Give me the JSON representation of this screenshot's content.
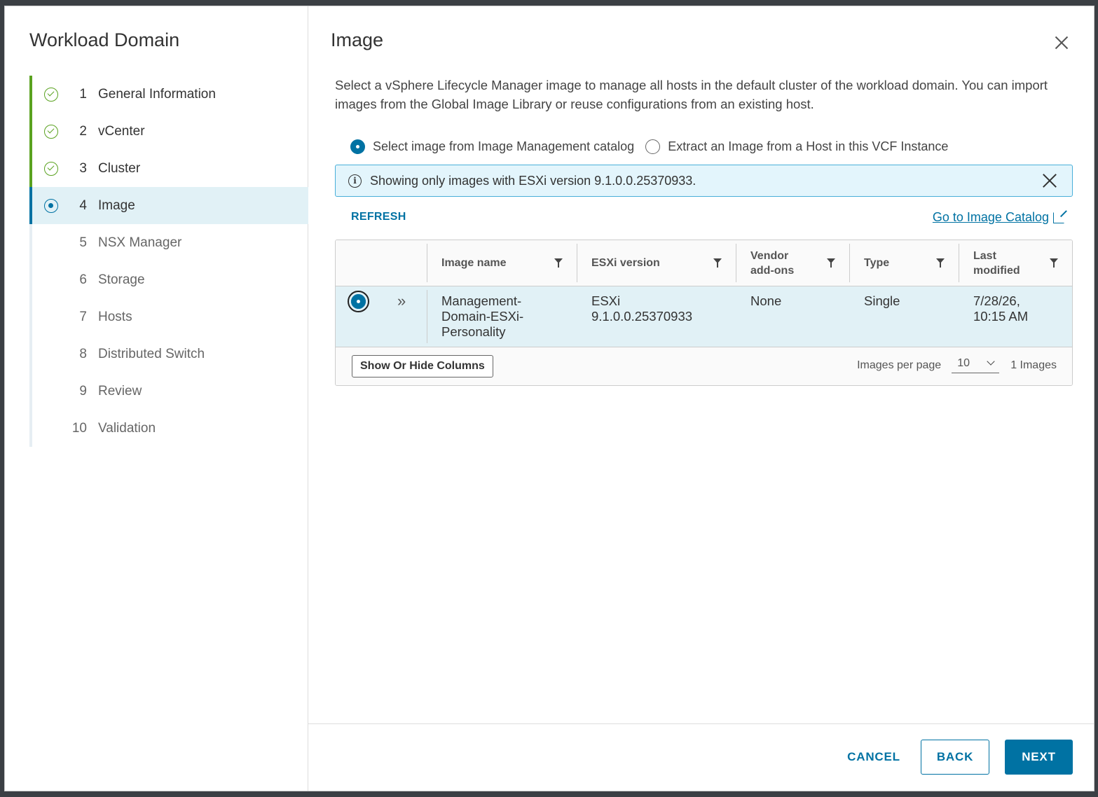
{
  "sidebar": {
    "title": "Workload Domain",
    "steps": [
      {
        "num": "1",
        "label": "General Information",
        "state": "done"
      },
      {
        "num": "2",
        "label": "vCenter",
        "state": "done"
      },
      {
        "num": "3",
        "label": "Cluster",
        "state": "done"
      },
      {
        "num": "4",
        "label": "Image",
        "state": "active"
      },
      {
        "num": "5",
        "label": "NSX Manager",
        "state": "todo"
      },
      {
        "num": "6",
        "label": "Storage",
        "state": "todo"
      },
      {
        "num": "7",
        "label": "Hosts",
        "state": "todo"
      },
      {
        "num": "8",
        "label": "Distributed Switch",
        "state": "todo"
      },
      {
        "num": "9",
        "label": "Review",
        "state": "todo"
      },
      {
        "num": "10",
        "label": "Validation",
        "state": "todo"
      }
    ]
  },
  "main": {
    "title": "Image",
    "description": "Select a vSphere Lifecycle Manager image to manage all hosts in the default cluster of the workload domain. You can import images from the Global Image Library or reuse configurations from an existing host.",
    "options": {
      "catalog": "Select image from Image Management catalog",
      "extract": "Extract an Image from a Host in this VCF Instance",
      "selected": "catalog"
    },
    "banner": {
      "text": "Showing only images with ESXi version 9.1.0.0.25370933."
    },
    "refresh_label": "REFRESH",
    "catalog_link": "Go to Image Catalog",
    "grid": {
      "columns": {
        "image_name": "Image name",
        "esxi_version": "ESXi version",
        "vendor_addons_1": "Vendor",
        "vendor_addons_2": "add-ons",
        "type": "Type",
        "last_modified_1": "Last",
        "last_modified_2": "modified"
      },
      "rows": [
        {
          "name_1": "Management-",
          "name_2": "Domain-ESXi-",
          "name_3": "Personality",
          "esxi_1": "ESXi",
          "esxi_2": "9.1.0.0.25370933",
          "vendor": "None",
          "type": "Single",
          "modified_1": "7/28/26,",
          "modified_2": "10:15 AM"
        }
      ],
      "show_hide_label": "Show Or Hide Columns",
      "per_page_label": "Images per page",
      "per_page_value": "10",
      "count_label": "1 Images"
    }
  },
  "footer": {
    "cancel": "CANCEL",
    "back": "BACK",
    "next": "NEXT"
  },
  "colors": {
    "accent": "#0072a3",
    "success": "#5aa220",
    "active_bg": "#e1f1f6",
    "info_border": "#49afd9"
  }
}
